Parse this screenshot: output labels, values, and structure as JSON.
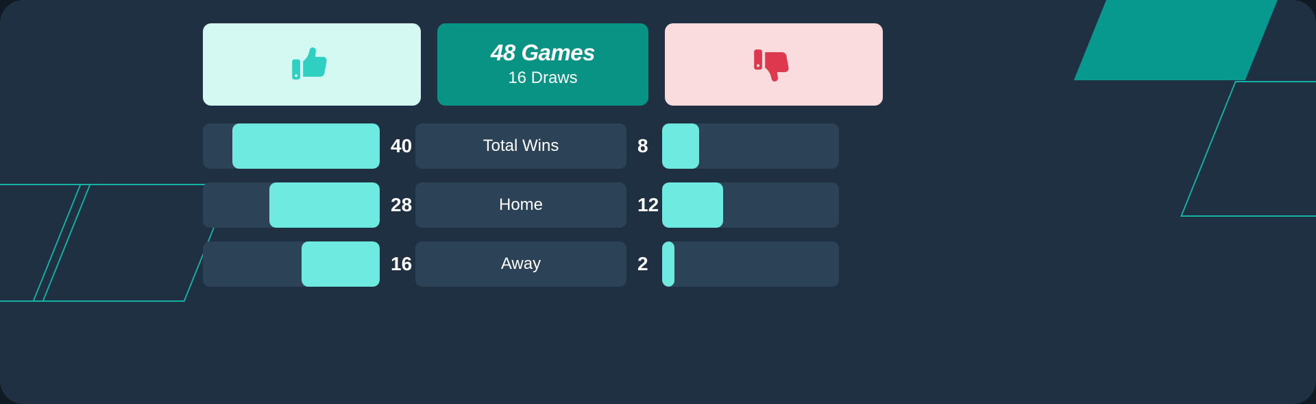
{
  "theme": {
    "background": "#1e3041",
    "track": "#2c4257",
    "fill_mint": "#6feae0",
    "card_up_bg": "#d4f8f2",
    "card_mid_bg": "#089384",
    "card_down_bg": "#fadcdf",
    "thumb_up_color": "#2fd0c2",
    "thumb_down_color": "#dd384e",
    "deco_teal_fill": "#07998d",
    "deco_teal_stroke": "#12b5a5",
    "text_white": "#ffffff"
  },
  "header": {
    "thumbs_up_icon": "thumbs-up-icon",
    "games_total": "48 Games",
    "draws": "16 Draws",
    "thumbs_down_icon": "thumbs-down-icon"
  },
  "chart_data": {
    "type": "bar",
    "title": "48 Games",
    "subtitle": "16 Draws",
    "orientation": "horizontal-diverging",
    "categories": [
      "Total Wins",
      "Home",
      "Away"
    ],
    "series": [
      {
        "name": "left",
        "values": [
          40,
          28,
          16
        ]
      },
      {
        "name": "right",
        "values": [
          8,
          12,
          2
        ]
      }
    ],
    "max_value": 48,
    "legend": "none",
    "grid": false,
    "xlabel": "",
    "ylabel": ""
  },
  "rows": [
    {
      "label": "Total Wins",
      "left_value": "40",
      "right_value": "8",
      "left_pct": 83.3,
      "right_pct": 20.8
    },
    {
      "label": "Home",
      "left_value": "28",
      "right_value": "12",
      "left_pct": 62.5,
      "right_pct": 34.5
    },
    {
      "label": "Away",
      "left_value": "16",
      "right_value": "2",
      "left_pct": 44.0,
      "right_pct": 7.0
    }
  ],
  "decorations": [
    {
      "name": "parallelogram-filled-top-right"
    },
    {
      "name": "parallelogram-outline-top-right"
    },
    {
      "name": "parallelogram-outline-left-upper"
    },
    {
      "name": "parallelogram-outline-left-lower"
    }
  ]
}
